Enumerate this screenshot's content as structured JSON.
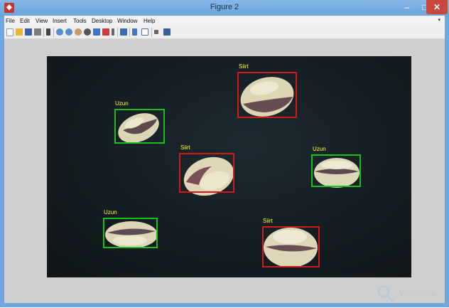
{
  "window": {
    "title": "Figure 2",
    "controls": {
      "minimize": "–",
      "maximize": "□",
      "close": "✕"
    }
  },
  "menubar": {
    "items": [
      "File",
      "Edit",
      "View",
      "Insert",
      "Tools",
      "Desktop",
      "Window",
      "Help"
    ],
    "overflow": "▾"
  },
  "toolbar": {
    "buttons": [
      "new-figure",
      "open-file",
      "save-figure",
      "print-figure",
      "edit-plot",
      "zoom-in",
      "zoom-out",
      "pan",
      "rotate-3d",
      "data-cursor",
      "brush",
      "link-plot",
      "insert-colorbar",
      "insert-legend",
      "hide-plot-tools",
      "show-plot-tools"
    ]
  },
  "figure": {
    "detections": [
      {
        "label": "Uzun",
        "class": "uzun",
        "color": "#18c018"
      },
      {
        "label": "Siirt",
        "class": "siirt",
        "color": "#d01a1a"
      },
      {
        "label": "Siirt",
        "class": "siirt",
        "color": "#d01a1a"
      },
      {
        "label": "Uzun",
        "class": "uzun",
        "color": "#18c018"
      },
      {
        "label": "Uzun",
        "class": "uzun",
        "color": "#18c018"
      },
      {
        "label": "Siirt",
        "class": "siirt",
        "color": "#d01a1a"
      }
    ]
  },
  "watermark": {
    "text": "Window'u"
  }
}
